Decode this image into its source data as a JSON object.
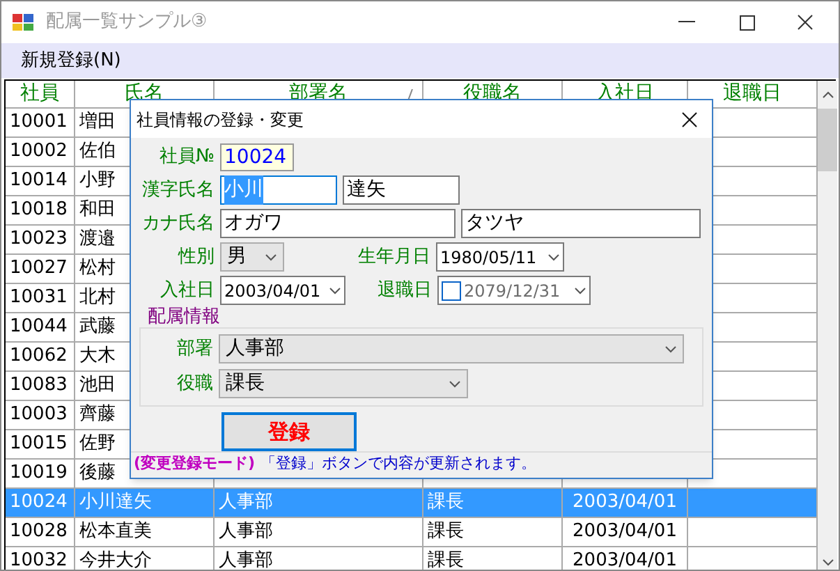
{
  "window": {
    "title": "配属一覧サンプル③"
  },
  "menu": [
    {
      "label": "新規登録(N)"
    }
  ],
  "table": {
    "columns": [
      "社員",
      "氏名",
      "部署名",
      "役職名",
      "入社日",
      "退職日"
    ],
    "rows": [
      {
        "cells": [
          "10001",
          "増田"
        ],
        "selected": false
      },
      {
        "cells": [
          "10002",
          "佐伯"
        ],
        "selected": false
      },
      {
        "cells": [
          "10014",
          "小野"
        ],
        "selected": false
      },
      {
        "cells": [
          "10018",
          "和田"
        ],
        "selected": false
      },
      {
        "cells": [
          "10023",
          "渡邉"
        ],
        "selected": false
      },
      {
        "cells": [
          "10027",
          "松村"
        ],
        "selected": false
      },
      {
        "cells": [
          "10031",
          "北村"
        ],
        "selected": false
      },
      {
        "cells": [
          "10044",
          "武藤"
        ],
        "selected": false
      },
      {
        "cells": [
          "10062",
          "大木"
        ],
        "selected": false
      },
      {
        "cells": [
          "10083",
          "池田"
        ],
        "selected": false
      },
      {
        "cells": [
          "10003",
          "齊藤"
        ],
        "selected": false
      },
      {
        "cells": [
          "10015",
          "佐野"
        ],
        "selected": false
      },
      {
        "cells": [
          "10019",
          "後藤"
        ],
        "selected": false
      },
      {
        "cells": [
          "10024",
          "小川達矢",
          "人事部",
          "課長",
          "2003/04/01"
        ],
        "selected": true
      },
      {
        "cells": [
          "10028",
          "松本直美",
          "人事部",
          "課長",
          "2003/04/01"
        ],
        "selected": false
      },
      {
        "cells": [
          "10032",
          "今井大介",
          "人事部",
          "課長",
          "2003/04/01"
        ],
        "selected": false
      }
    ]
  },
  "dialog": {
    "title": "社員情報の登録・変更",
    "employee_no": {
      "label": "社員№",
      "value": "10024"
    },
    "kanji_name": {
      "label": "漢字氏名",
      "last": "小川",
      "first": "達矢"
    },
    "kana_name": {
      "label": "カナ氏名",
      "last": "オガワ",
      "first": "タツヤ"
    },
    "gender": {
      "label": "性別",
      "value": "男"
    },
    "birth_date": {
      "label": "生年月日",
      "value": "1980/05/11"
    },
    "hire_date": {
      "label": "入社日",
      "value": "2003/04/01"
    },
    "retire_date": {
      "label": "退職日",
      "value": "2079/12/31",
      "checked": false
    },
    "assignment": {
      "title": "配属情報",
      "department": {
        "label": "部署",
        "value": "人事部"
      },
      "position": {
        "label": "役職",
        "value": "課長"
      }
    },
    "submit": "登録",
    "status": {
      "mode": "(変更登録モード)",
      "message": "「登録」ボタンで内容が更新されます。"
    }
  }
}
